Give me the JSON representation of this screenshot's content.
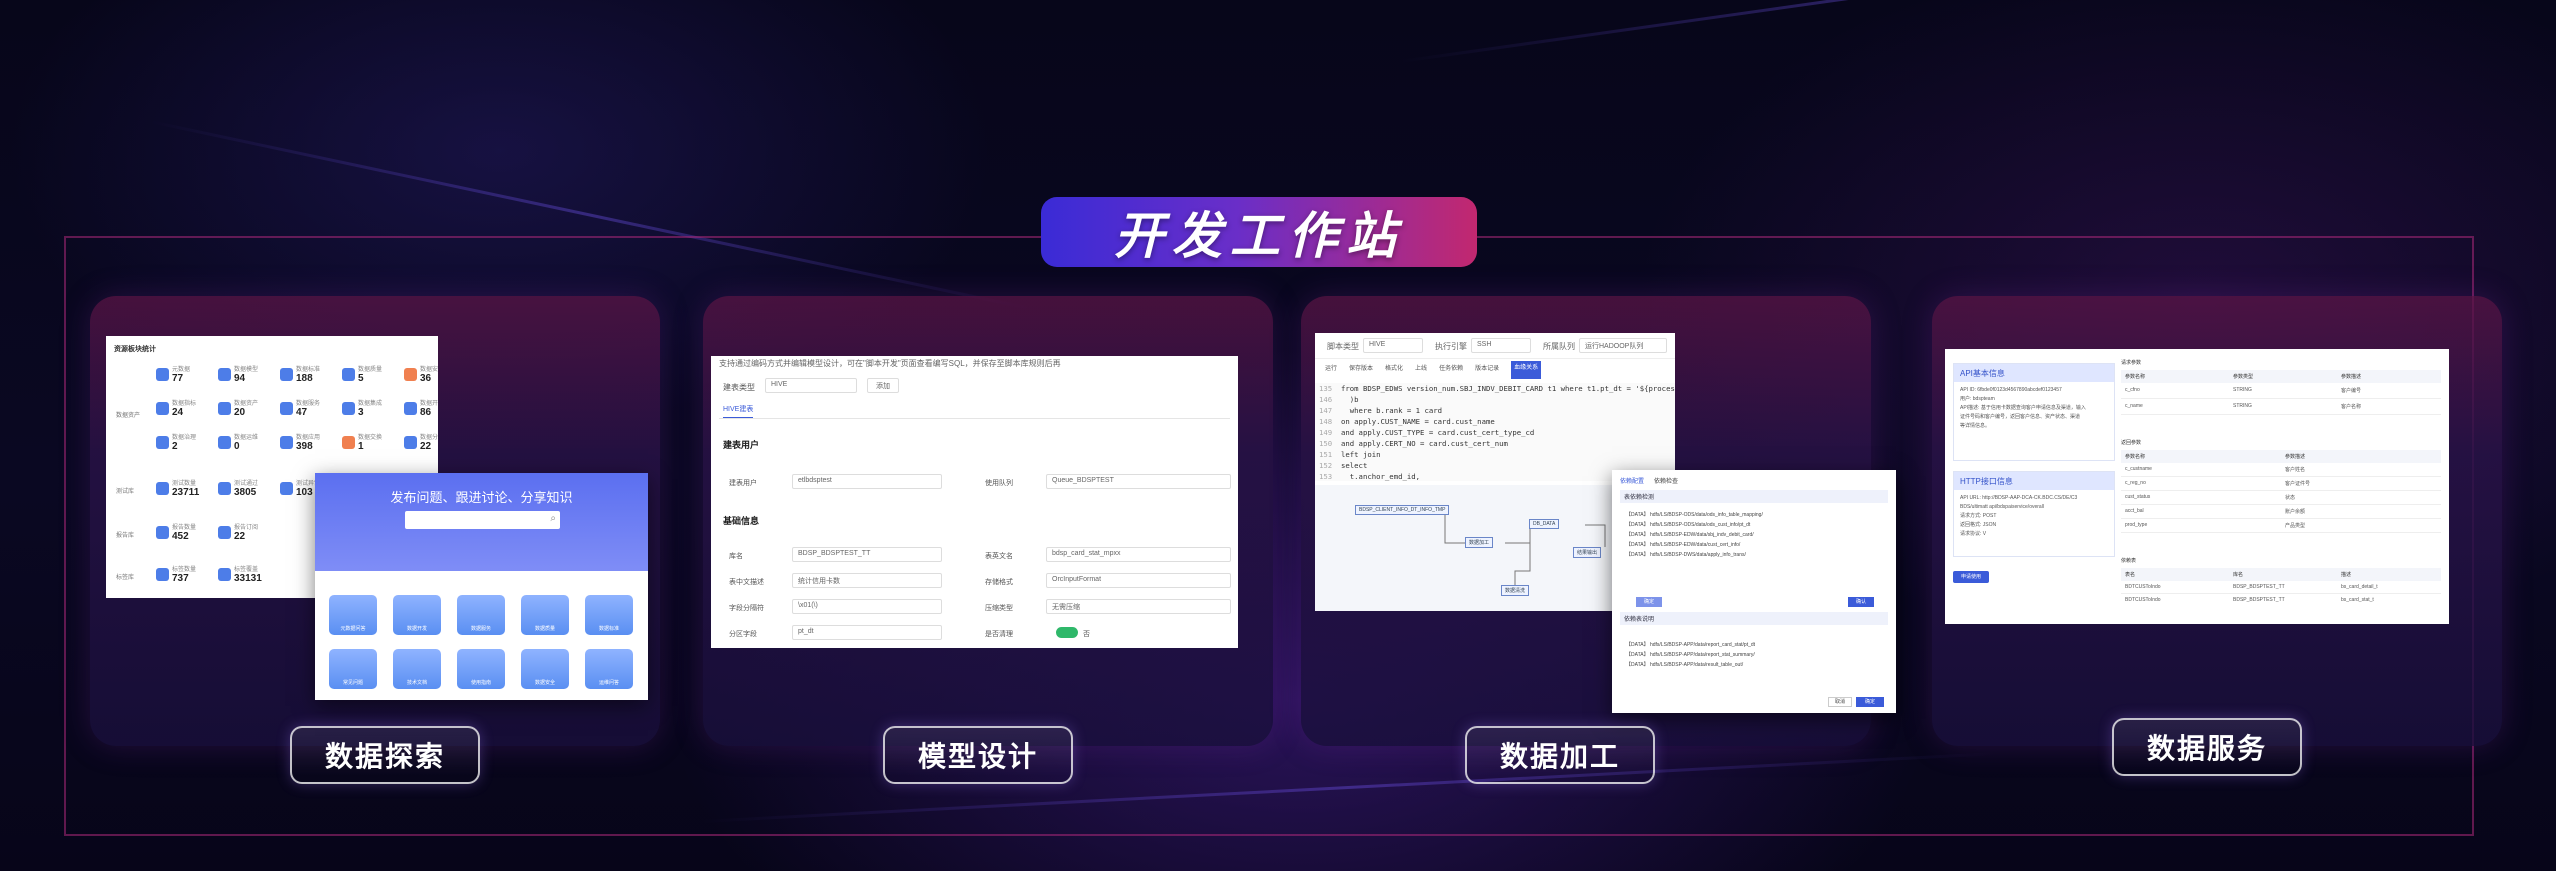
{
  "page": {
    "title": "开发工作站",
    "colors": {
      "accent_blue": "#3a2bd6",
      "accent_pink": "#c2286f",
      "background": "#07061a"
    }
  },
  "cards": [
    {
      "label": "数据探索"
    },
    {
      "label": "模型设计"
    },
    {
      "label": "数据加工"
    },
    {
      "label": "数据服务"
    }
  ],
  "explore": {
    "dashboard_title": "资源板块统计",
    "groups": [
      "数据资产",
      "测试库",
      "报告库",
      "标签库"
    ],
    "stats_row1": [
      {
        "label": "元数据",
        "value": "77"
      },
      {
        "label": "数据模型",
        "value": "94"
      },
      {
        "label": "数据标准",
        "value": "188"
      },
      {
        "label": "数据质量",
        "value": "5"
      },
      {
        "label": "数据安全",
        "value": "36"
      }
    ],
    "stats_row2": [
      {
        "label": "数据指标",
        "value": "24"
      },
      {
        "label": "数据资产",
        "value": "20"
      },
      {
        "label": "数据服务",
        "value": "47"
      },
      {
        "label": "数据集成",
        "value": "3"
      },
      {
        "label": "数据开发",
        "value": "86"
      }
    ],
    "stats_row3": [
      {
        "label": "数据治理",
        "value": "2"
      },
      {
        "label": "数据运维",
        "value": "0"
      },
      {
        "label": "数据应用",
        "value": "398"
      },
      {
        "label": "数据交换",
        "value": "1"
      },
      {
        "label": "数据分析",
        "value": "22"
      }
    ],
    "stats_row4": [
      {
        "label": "测试数量",
        "value": "23711"
      },
      {
        "label": "测试通过",
        "value": "3805"
      },
      {
        "label": "测试异常",
        "value": "103"
      }
    ],
    "stats_row5": [
      {
        "label": "报告数量",
        "value": "452"
      },
      {
        "label": "报告订阅",
        "value": "22"
      }
    ],
    "stats_row6": [
      {
        "label": "标签数量",
        "value": "737"
      },
      {
        "label": "标签覆盖",
        "value": "33131"
      }
    ],
    "forum_title": "发布问题、跟进讨论、分享知识",
    "tiles": [
      "元数据问答",
      "数据开发",
      "数据服务",
      "数据质量",
      "数据标准",
      "常见问题",
      "技术文档",
      "使用指南",
      "数据安全",
      "运维问答"
    ]
  },
  "model": {
    "hint": "支持通过编码方式并编辑模型设计，可在\"脚本开发\"页面查看编写SQL，并保存至脚本库规则后再",
    "hint_link": "脚本开发",
    "table_type_label": "建表类型",
    "table_type_value": "HIVE",
    "add_button": "添加",
    "tab": "HIVE建表",
    "section_user": "建表用户",
    "owner_label": "建表用户",
    "owner_value": "etlbdsptest",
    "queue_label": "使用队列",
    "queue_value": "Queue_BDSPTEST",
    "section_basic": "基础信息",
    "db_label": "库名",
    "db_value": "BDSP_BDSPTEST_TT",
    "table_label": "表英文名",
    "table_value": "bdsp_card_stat_mpxx",
    "desc_label": "表中文描述",
    "desc_value": "统计信用卡数",
    "storage_label": "存储格式",
    "storage_value": "OrcInputFormat",
    "delim_label": "字段分隔符",
    "delim_value": "\\x01(\\)",
    "compress_label": "压缩类型",
    "compress_value": "无需压缩",
    "part_label": "分区字段",
    "part_value": "pt_dt",
    "lifecycle_label": "是否清理",
    "switch_no": "否"
  },
  "process": {
    "filter_labels": [
      "脚本类型",
      "执行引擎",
      "所属队列"
    ],
    "filter_values": [
      "HIVE",
      "SSH",
      "运行HADOOP队列"
    ],
    "tabs": [
      "运行",
      "保存版本",
      "格式化",
      "上线",
      "任务依赖",
      "版本记录",
      "血缘关系"
    ],
    "code_lines": [
      {
        "n": "135",
        "t": "from BDSP_EDWS version_num.SBJ_INDV_DEBIT_CARD t1 where t1.pt_dt = '${process_date}' and"
      },
      {
        "n": "146",
        "t": "  )b"
      },
      {
        "n": "147",
        "t": "  where b.rank = 1 card"
      },
      {
        "n": "148",
        "t": "on apply.CUST_NAME = card.cust_name"
      },
      {
        "n": "149",
        "t": "and apply.CUST_TYPE = card.cust_cert_type_cd"
      },
      {
        "n": "150",
        "t": "and apply.CERT_NO = card.cust_cert_num"
      },
      {
        "n": "151",
        "t": "left join"
      },
      {
        "n": "152",
        "t": "select"
      },
      {
        "n": "153",
        "t": "  t.anchor_emd_id,"
      }
    ],
    "dag_nodes": [
      "BDSP_CLIENT_INFO_DT_INFO_TMP",
      "数据加工",
      "DB_DATA",
      "结果输出",
      "数据清洗"
    ],
    "dialog_tabs": [
      "依赖配置",
      "依赖检查"
    ],
    "dialog_section": "表依赖检测",
    "dialog_section2": "依赖表说明",
    "dialog_lines": [
      "【DATA】 hdfs/LS/BDSP-ODS/data/ods_info_table_mapping/",
      "【DATA】 hdfs/LS/BDSP-ODS/data/ods_cust_info/pt_dt",
      "【DATA】 hdfs/LS/BDSP-EDW/data/sbj_indv_debit_card/",
      "【DATA】 hdfs/LS/BDSP-EDW/data/cust_cert_info/",
      "【DATA】 hdfs/LS/BDSP-DWS/data/apply_info_trans/"
    ],
    "dialog_lines2": [
      "【DATA】 hdfs/LS/BDSP-APP/data/report_card_stat/pt_dt",
      "【DATA】 hdfs/LS/BDSP-APP/data/report_stat_summary/",
      "【DATA】 hdfs/LS/BDSP-APP/data/result_table_out/"
    ],
    "btn_ok": "确定",
    "btn_cancel": "取消",
    "btn_confirm": "确认"
  },
  "service": {
    "api_box_title": "API基本信息",
    "api_lines": [
      "API ID: 6fbde0f0123d4567890abcdef0123457",
      "用户: bdspteam",
      "API描述: 基于信用卡数据查询客户申请信息及渠道，输入",
      "证件号码和客户编号，返回客户信息、资产状态、渠道",
      "等详情信息。"
    ],
    "http_box_title": "HTTP接口信息",
    "http_lines": [
      "API URL: http://BDSP-AAP-DCA-CK.BDC.CS/DE/C3",
      "BDS/ultimatt api/bdspaiservice/overall",
      "请求方式: POST",
      "返回格式: JSON",
      "请求协议: V"
    ],
    "apply_button": "申请使用",
    "table1_title": "请求参数",
    "table1_headers": [
      "参数名称",
      "参数类型",
      "参数描述"
    ],
    "table1_rows": [
      [
        "c_cfno",
        "STRING",
        "客户编号"
      ],
      [
        "c_name",
        "STRING",
        "客户名称"
      ]
    ],
    "table2_title": "返回参数",
    "table2_headers": [
      "参数名称",
      "参数描述"
    ],
    "table2_rows": [
      [
        "c_custname",
        "客户姓名"
      ],
      [
        "c_reg_no",
        "客户证件号"
      ],
      [
        "cust_status",
        "状态"
      ],
      [
        "acct_bal",
        "账户余额"
      ],
      [
        "prod_type",
        "产品类型"
      ]
    ],
    "table3_title": "依赖表",
    "table3_headers": [
      "表名",
      "库名",
      "描述"
    ],
    "table3_rows": [
      [
        "BDTCUSToIndo",
        "BDSP_BDSPTEST_TT",
        "bs_card_detail_t"
      ],
      [
        "BDTCUSToIndo",
        "BDSP_BDSPTEST_TT",
        "bs_card_stat_t"
      ]
    ]
  }
}
